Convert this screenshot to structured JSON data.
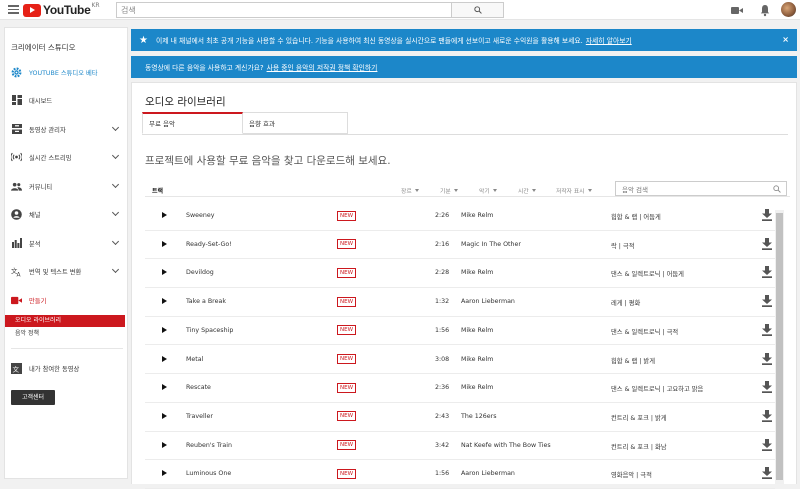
{
  "topbar": {
    "logo_word": "YouTube",
    "logo_region": "KR",
    "search_placeholder": "검색"
  },
  "sidebar": {
    "title": "크리에이터 스튜디오",
    "items": [
      {
        "label": "YOUTUBE 스튜디오 베타",
        "icon": "gear-icon",
        "chevron": false
      },
      {
        "label": "대시보드",
        "icon": "dashboard-icon",
        "chevron": false
      },
      {
        "label": "동영상 관리자",
        "icon": "video-manager-icon",
        "chevron": true
      },
      {
        "label": "실시간 스트리밍",
        "icon": "live-icon",
        "chevron": true
      },
      {
        "label": "커뮤니티",
        "icon": "community-icon",
        "chevron": true
      },
      {
        "label": "채널",
        "icon": "channel-icon",
        "chevron": true
      },
      {
        "label": "분석",
        "icon": "analytics-icon",
        "chevron": true
      },
      {
        "label": "번역 및 텍스트 변환",
        "icon": "translate-icon",
        "chevron": true
      },
      {
        "label": "만들기",
        "icon": "create-icon",
        "chevron": false
      }
    ],
    "sub_items": [
      {
        "label": "오디오 라이브러리",
        "active": true
      },
      {
        "label": "음악 정책",
        "active": false
      }
    ],
    "contributed": "내가 참여한 동영상",
    "help_button": "고객센터"
  },
  "banner1": {
    "text": "이제 내 채널에서 최초 공개 기능을 사용할 수 있습니다. 기능을 사용하여 최신 동영상을 실시간으로 팬들에게 선보이고 새로운 수익원을 활용해 보세요.",
    "link": "자세히 알아보기",
    "close": "×"
  },
  "banner2": {
    "text": "동영상에 다른 음악을 사용하고 계신가요?",
    "link": "사용 중인 음악의 저작권 정책 확인하기"
  },
  "main": {
    "title": "오디오 라이브러리",
    "tabs": [
      "무료 음악",
      "음향 효과"
    ],
    "intro": "프로젝트에 사용할 무료 음악을 찾고 다운로드해 보세요.",
    "header": {
      "track": "트랙",
      "filters": [
        "장르",
        "기분",
        "악기",
        "시간",
        "저작자 표시"
      ],
      "search_placeholder": "음악 검색"
    },
    "new_badge": "NEW",
    "tracks": [
      {
        "title": "Sweeney",
        "duration": "2:26",
        "artist": "Mike Relm",
        "genre": "힙합 & 랩 | 어둡게",
        "new": true
      },
      {
        "title": "Ready-Set-Go!",
        "duration": "2:16",
        "artist": "Magic In The Other",
        "genre": "락 | 극적",
        "new": true
      },
      {
        "title": "Devildog",
        "duration": "2:28",
        "artist": "Mike Relm",
        "genre": "댄스 & 일렉트로닉 | 어둡게",
        "new": true
      },
      {
        "title": "Take a Break",
        "duration": "1:32",
        "artist": "Aaron Lieberman",
        "genre": "레게 | 평화",
        "new": true
      },
      {
        "title": "Tiny Spaceship",
        "duration": "1:56",
        "artist": "Mike Relm",
        "genre": "댄스 & 일렉트로닉 | 극적",
        "new": true
      },
      {
        "title": "Metal",
        "duration": "3:08",
        "artist": "Mike Relm",
        "genre": "힙합 & 랩 | 밝게",
        "new": true
      },
      {
        "title": "Rescate",
        "duration": "2:36",
        "artist": "Mike Relm",
        "genre": "댄스 & 일렉트로닉 | 고요하고 맑음",
        "new": true
      },
      {
        "title": "Traveller",
        "duration": "2:43",
        "artist": "The 126ers",
        "genre": "컨트리 & 포크 | 밝게",
        "new": true
      },
      {
        "title": "Reuben's Train",
        "duration": "3:42",
        "artist": "Nat Keefe with The Bow Ties",
        "genre": "컨트리 & 포크 | 화남",
        "new": true
      },
      {
        "title": "Luminous One",
        "duration": "1:56",
        "artist": "Aaron Lieberman",
        "genre": "영화음악 | 극적",
        "new": true
      }
    ]
  },
  "colors": {
    "accent": "#cc181e",
    "banner": "#1c87c9",
    "logo": "#e62117"
  }
}
